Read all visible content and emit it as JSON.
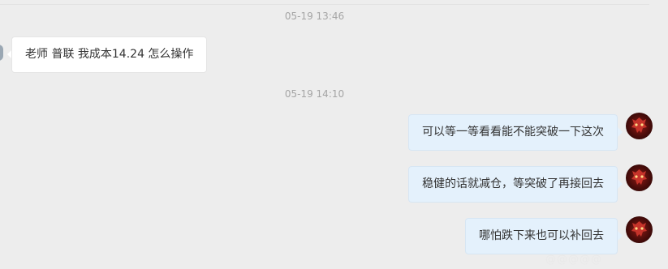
{
  "chat": {
    "timestamps": [
      "05-19 13:46",
      "05-19 14:10"
    ],
    "messages": [
      {
        "side": "in",
        "text": "老师 普联 我成本14.24 怎么操作"
      },
      {
        "side": "out",
        "text": "可以等一等看看能不能突破一下这次"
      },
      {
        "side": "out",
        "text": "稳健的话就减仓，等突破了再接回去"
      },
      {
        "side": "out",
        "text": "哪怕跌下来也可以补回去"
      }
    ],
    "watermark": "@@@@@"
  },
  "icons": {
    "sender_avatar": "dragon-mask-icon",
    "receiver_avatar": "person-avatar-icon"
  },
  "colors": {
    "background": "#ededed",
    "incoming_bubble": "#ffffff",
    "outgoing_bubble": "#e4f1fc",
    "timestamp_text": "#a5a5a5",
    "avatar_red": "#8d1b16"
  }
}
